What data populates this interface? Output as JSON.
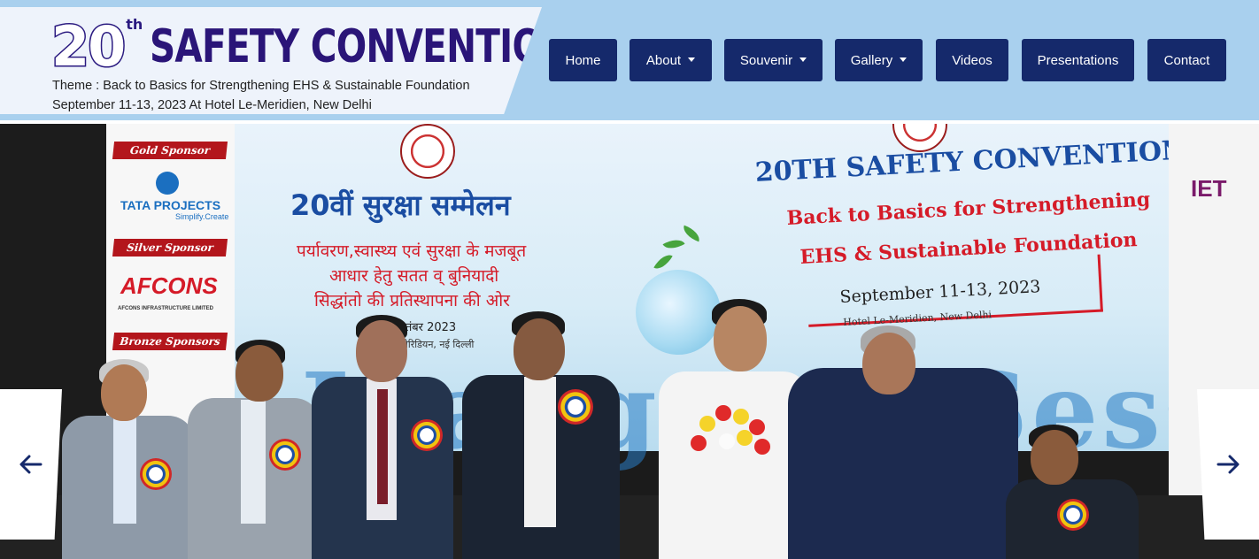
{
  "header": {
    "logo_number": "20",
    "logo_superscript": "th",
    "logo_title": "SAFETY CONVENTION",
    "theme": "Theme : Back to Basics for Strengthening EHS & Sustainable Foundation",
    "date_venue": "September 11-13, 2023 At Hotel Le-Meridien, New Delhi"
  },
  "nav": {
    "items": [
      {
        "label": "Home",
        "dropdown": false
      },
      {
        "label": "About",
        "dropdown": true
      },
      {
        "label": "Souvenir",
        "dropdown": true
      },
      {
        "label": "Gallery",
        "dropdown": true
      },
      {
        "label": "Videos",
        "dropdown": false
      },
      {
        "label": "Presentations",
        "dropdown": false
      },
      {
        "label": "Contact",
        "dropdown": false
      }
    ]
  },
  "slide": {
    "sponsors": {
      "gold_label": "Gold Sponsor",
      "gold_name": "TATA PROJECTS",
      "gold_tagline": "Simplify.Create",
      "silver_label": "Silver Sponsor",
      "silver_name": "AFCONS",
      "silver_sub": "AFCONS INFRASTRUCTURE LIMITED",
      "bronze_label": "Bronze Sponsors"
    },
    "hindi_title": "20वीं सुरक्षा सम्मेलन",
    "hindi_lines": [
      "पर्यावरण,स्वास्थ्य एवं सुरक्षा के मजबूत",
      "आधार हेतु सतत व् बुनियादी",
      "सिद्धांतो की प्रतिस्थापना की ओर"
    ],
    "hindi_date": "13 सितंबर 2023",
    "hindi_venue": "ली-मेरिडियन, नई दिल्ली",
    "en_title": "20TH SAFETY CONVENTION",
    "en_sub_1": "Back to Basics for Strengthening",
    "en_sub_2": "EHS & Sustainable Foundation",
    "en_date": "September 11-13, 2023",
    "en_venue": "Hotel Le-Meridien, New Delhi",
    "watermark": "Inaugural Session",
    "right_logo": "IET"
  },
  "carousel": {
    "prev_icon": "arrow-left-icon",
    "next_icon": "arrow-right-icon",
    "arrow_color": "#15296b"
  },
  "colors": {
    "header_bg": "#a9d0ee",
    "nav_bg": "#15296b",
    "brand_text": "#2a1578"
  }
}
